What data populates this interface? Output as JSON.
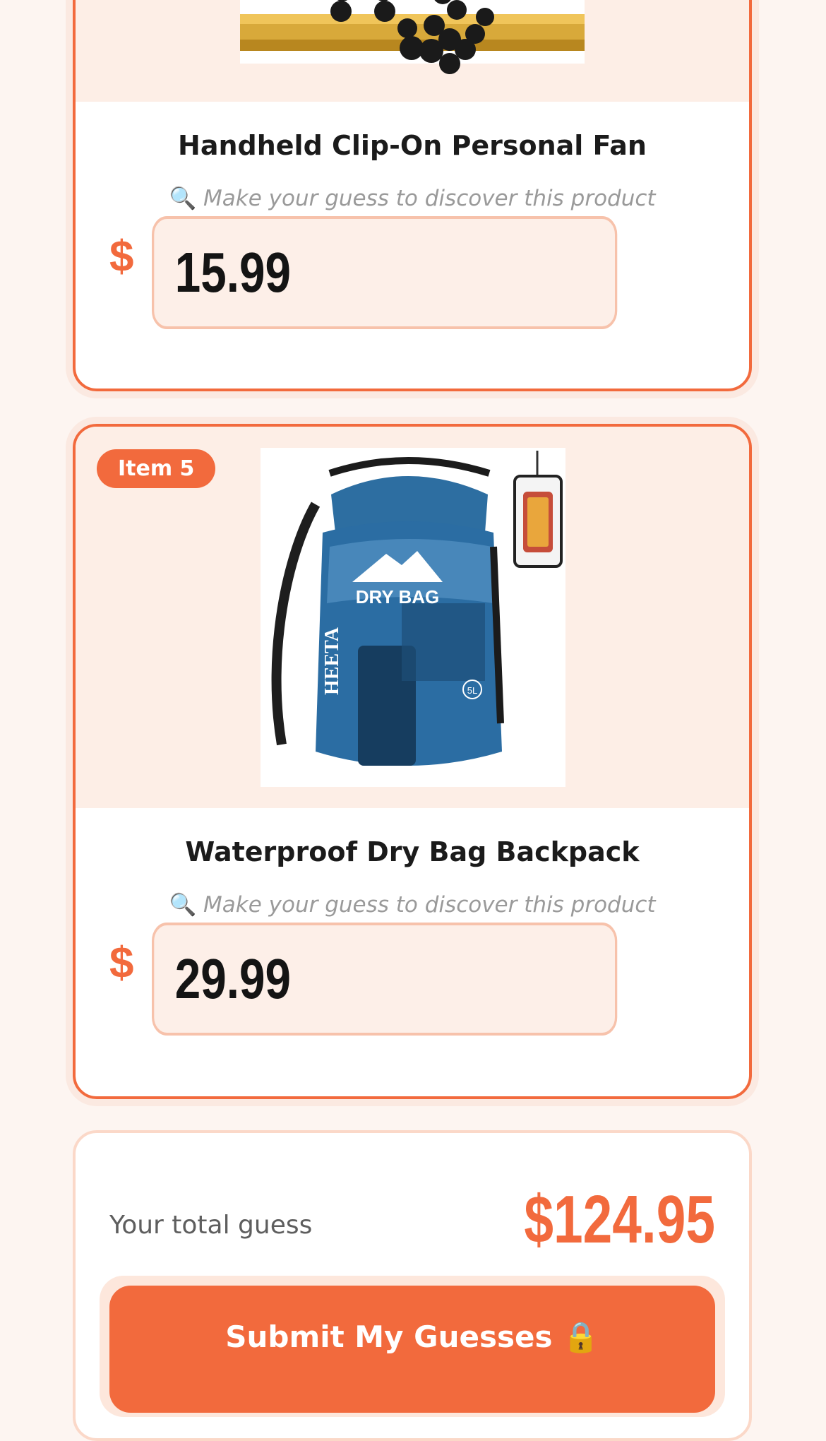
{
  "items": [
    {
      "title": "Handheld Clip-On Personal Fan",
      "hint": "Make your guess to discover this product",
      "currency": "$",
      "price": "15.99",
      "image_icon": "fan-on-gold-bar-image"
    },
    {
      "badge": "Item 5",
      "title": "Waterproof Dry Bag Backpack",
      "hint": "Make your guess to discover this product",
      "currency": "$",
      "price": "29.99",
      "image_icon": "dry-bag-image",
      "image_text": {
        "bag_label": "DRY BAG",
        "brand": "HEETA",
        "size": "5L"
      }
    }
  ],
  "hint_icon": "🔍",
  "summary": {
    "total_label": "Your total guess",
    "total_value": "$124.95"
  },
  "submit": {
    "label": "Submit My Guesses",
    "icon": "🔒"
  },
  "colors": {
    "accent": "#f26a3d",
    "background": "#fdf5f1",
    "input_bg": "#fdefe8"
  }
}
